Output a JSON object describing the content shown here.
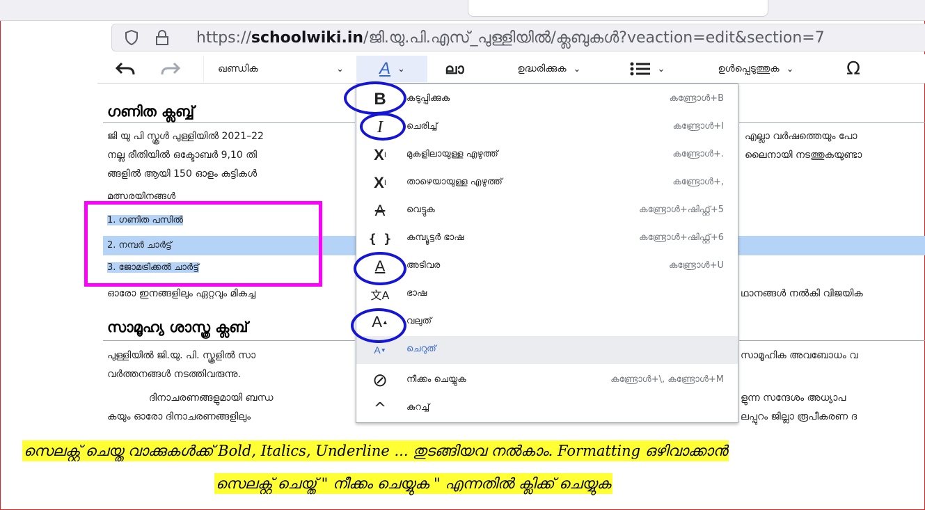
{
  "browser": {
    "url_prefix": "https://",
    "url_domain": "schoolwiki.in",
    "url_path": "/ജി.യു.പി.എസ്_പുള്ളിയിൽ/ക്ലബുകൾ?veaction=edit&section=7"
  },
  "toolbar": {
    "undo_icon": "undo-icon",
    "redo_icon": "redo-icon",
    "paragraph_label": "ഖണ്ഡിക",
    "style_icon_label": "A",
    "link_icon": "ലാ",
    "cite_label": "ഉദ്ധരിക്കുക",
    "list_icon": "list-icon",
    "insert_label": "ഉൾപ്പെടുത്തുക",
    "special_char_label": "Ω"
  },
  "article": {
    "heading1": "ഗണിത ക്ലബ്ബ്",
    "para1_line1_left": "ജി യു പി സ്കൂൾ പുള്ളിയിൽ 2021–22",
    "para1_line1_right": "എല്ലാ വർഷത്തെയും പോ",
    "para1_line2_left": "നല്ല രീതിയിൽ ഒക്ടോബർ 9,10 തി",
    "para1_line2_right": "ലൈനായി നടത്തുകയുണ്ടാ",
    "para1_line3_left": "ങ്ങളിൽ ആയി 150 ഓളം കുട്ടികൾ",
    "competitions_label": "മത്സരയിനങ്ങൾ",
    "list_items": [
      "1. ഗണിത പസിൽ",
      "2. നമ്പർ ചാർട്ട്",
      "3. ജോമട്രിക്കൽ ചാർട്ട്"
    ],
    "para2_left": "ഓരോ ഇനങ്ങളിലും ഏറ്റവും മികച്ച",
    "para2_right": "ഥാനങ്ങൾ നൽകി വിജയിക",
    "heading2": "സാമൂഹ്യ ശാസ്ത്ര ക്ലബ്",
    "para3_line1_left": "പുള്ളിയിൽ ജി.യു. പി. സ്കൂളിൽ സാ",
    "para3_line1_right": "സാമൂഹിക അവബോധം  വ",
    "para3_line2_left": "വർത്തനങ്ങൾ നടത്തിവരുന്നു.",
    "para4_line1_left": "ദിനാചരണങ്ങളുമായി ബന്ധ",
    "para4_line1_right": "ളുന്ന സന്ദേശം അധ്യാപ",
    "para4_line2_left": "കയും  ഓരോ ദിനാചരണങ്ങളിലും",
    "para4_line2_right": "ലപ്പുറം ജില്ലാ രൂപീകരണ ദ"
  },
  "menu": {
    "items": [
      {
        "icon": "B",
        "label": "കടുപ്പിക്കുക",
        "shortcut": "കണ്ട്രോൾ+B"
      },
      {
        "icon": "I",
        "label": "ചെരിച്ച്",
        "shortcut": "കണ്ട്രോൾ+I"
      },
      {
        "icon": "X",
        "label": "മുകളിലായുള്ള എഴുത്ത്",
        "shortcut": "കണ്ട്രോൾ+."
      },
      {
        "icon": "X",
        "label": "താഴെയായുള്ള എഴുത്ത്",
        "shortcut": "കണ്ട്രോൾ+,"
      },
      {
        "icon": "A",
        "label": "വെട്ടുക",
        "shortcut": "കണ്ട്രോൾ+ഷിഫ്റ്റ്+5"
      },
      {
        "icon": "{ }",
        "label": "കമ്പ്യൂട്ടർ ഭാഷ",
        "shortcut": "കണ്ട്രോൾ+ഷിഫ്റ്റ്+6"
      },
      {
        "icon": "A",
        "label": "അടിവര",
        "shortcut": "കണ്ട്രോൾ+U"
      },
      {
        "icon": "文A",
        "label": "ഭാഷ",
        "shortcut": ""
      },
      {
        "icon": "A",
        "label": "വലുത്",
        "shortcut": ""
      },
      {
        "icon": "A",
        "label": "ചെറുത്",
        "shortcut": ""
      },
      {
        "icon": "⊘",
        "label": "നീക്കം ചെയ്യുക",
        "shortcut": "കണ്ട്രോൾ+\\, കണ്ട്രോൾ+M"
      },
      {
        "icon": "^",
        "label": "കുറച്ച്",
        "shortcut": ""
      }
    ]
  },
  "caption": {
    "line1": "സെലക്റ്റ് ചെയ്ത വാക്കുകൾക്ക്  Bold, Italics, Underline ...  തുടങ്ങിയവ നൽകാം. Formatting  ഒഴിവാക്കാൻ",
    "line2": "സെലക്റ്റ് ചെയ്ത്  \" നീക്കം ചെയ്യുക \" എന്നതിൽ ക്ലിക്ക് ചെയ്യുക"
  },
  "colors": {
    "annotation_circle": "#1515d6",
    "annotation_box": "#ff00ff",
    "selection": "#b4d3f7",
    "caption_bg": "#ffff33"
  }
}
